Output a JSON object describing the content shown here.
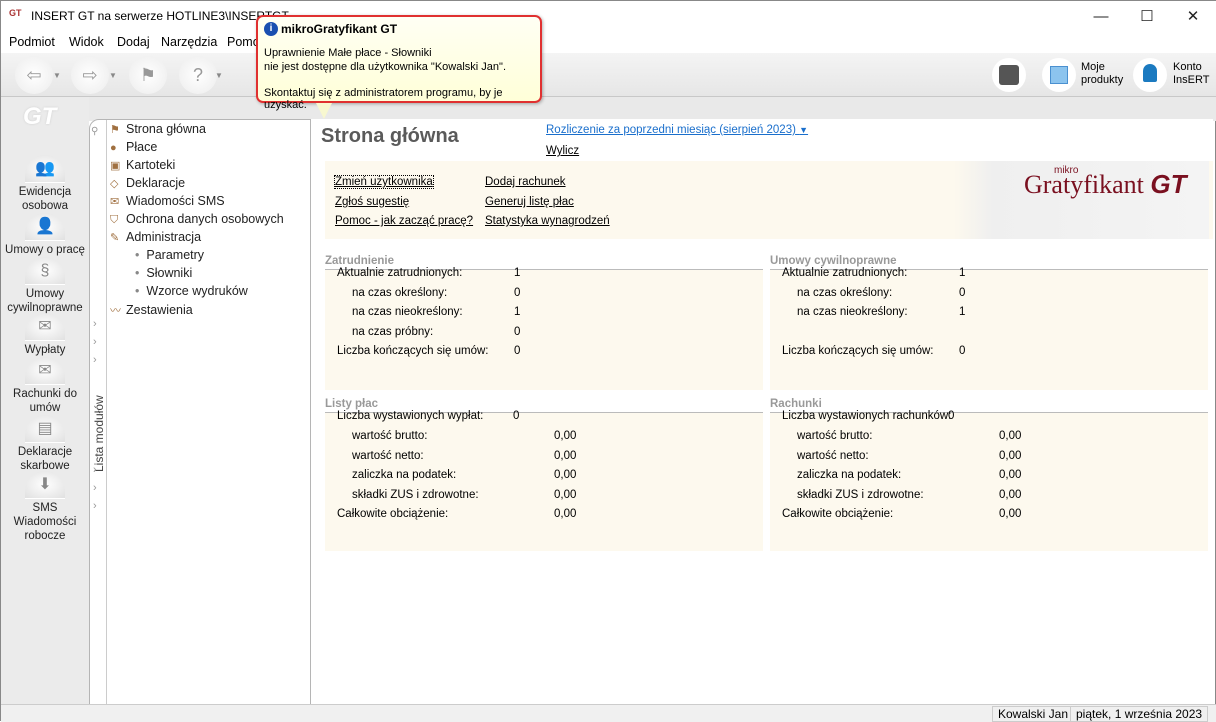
{
  "window": {
    "title": "INSERT GT na serwerze HOTLINE3\\INSERTGT",
    "minimize": "—",
    "maximize": "☐",
    "close": "✕"
  },
  "menu": [
    "Podmiot",
    "Widok",
    "Dodaj",
    "Narzędzia",
    "Pomoc"
  ],
  "toolbar_right": {
    "moje_produkty": "Moje produkty",
    "konto": "Konto InsERT"
  },
  "sidebar": [
    "Ewidencja osobowa",
    "Umowy o pracę",
    "Umowy cywilnoprawne",
    "Wypłaty",
    "Rachunki do umów",
    "Deklaracje skarbowe",
    "SMS Wiadomości robocze"
  ],
  "modules": {
    "label": "Lista modułów",
    "items": [
      "Strona główna",
      "Płace",
      "Kartoteki",
      "Deklaracje",
      "Wiadomości SMS",
      "Ochrona danych osobowych",
      "Administracja"
    ],
    "subitems": [
      "Parametry",
      "Słowniki",
      "Wzorce wydruków"
    ],
    "last": "Zestawienia"
  },
  "main": {
    "title": "Strona główna",
    "period": "Rozliczenie za poprzedni miesiąc (sierpień 2023)",
    "calc": "Wylicz",
    "links_left": [
      "Zmień użytkownika",
      "Zgłoś sugestię",
      "Pomoc - jak zacząć pracę?"
    ],
    "links_right": [
      "Dodaj rachunek",
      "Generuj listę płac",
      "Statystyka wynagrodzeń"
    ],
    "logo": "mikroGratyfikant GT"
  },
  "zatrudnienie": {
    "title": "Zatrudnienie",
    "rows": [
      [
        "Aktualnie zatrudnionych:",
        "1"
      ],
      [
        "na czas określony:",
        "0"
      ],
      [
        "na czas nieokreślony:",
        "1"
      ],
      [
        "na czas próbny:",
        "0"
      ],
      [
        "Liczba kończących się umów:",
        "0"
      ]
    ]
  },
  "umowy": {
    "title": "Umowy cywilnoprawne",
    "rows": [
      [
        "Aktualnie zatrudnionych:",
        "1"
      ],
      [
        "na czas określony:",
        "0"
      ],
      [
        "na czas nieokreślony:",
        "1"
      ],
      [
        "Liczba kończących się umów:",
        "0"
      ]
    ]
  },
  "listy": {
    "title": "Listy płac",
    "count_label": "Liczba wystawionych wypłat:",
    "count": "0",
    "rows": [
      [
        "wartość brutto:",
        "0,00"
      ],
      [
        "wartość netto:",
        "0,00"
      ],
      [
        "zaliczka na podatek:",
        "0,00"
      ],
      [
        "składki ZUS i zdrowotne:",
        "0,00"
      ],
      [
        "Całkowite obciążenie:",
        "0,00"
      ]
    ]
  },
  "rachunki": {
    "title": "Rachunki",
    "count_label": "Liczba wystawionych rachunków:",
    "count": "0",
    "rows": [
      [
        "wartość brutto:",
        "0,00"
      ],
      [
        "wartość netto:",
        "0,00"
      ],
      [
        "zaliczka na podatek:",
        "0,00"
      ],
      [
        "składki ZUS i zdrowotne:",
        "0,00"
      ],
      [
        "Całkowite obciążenie:",
        "0,00"
      ]
    ]
  },
  "status": {
    "user": "Kowalski Jan",
    "date": "piątek, 1 września 2023"
  },
  "tooltip": {
    "title": "mikroGratyfikant GT",
    "line1": "Uprawnienie Małe płace - Słowniki",
    "line2": "nie jest dostępne dla użytkownika \"Kowalski Jan\".",
    "line3": "Skontaktuj się z administratorem programu, by je uzyskać."
  }
}
